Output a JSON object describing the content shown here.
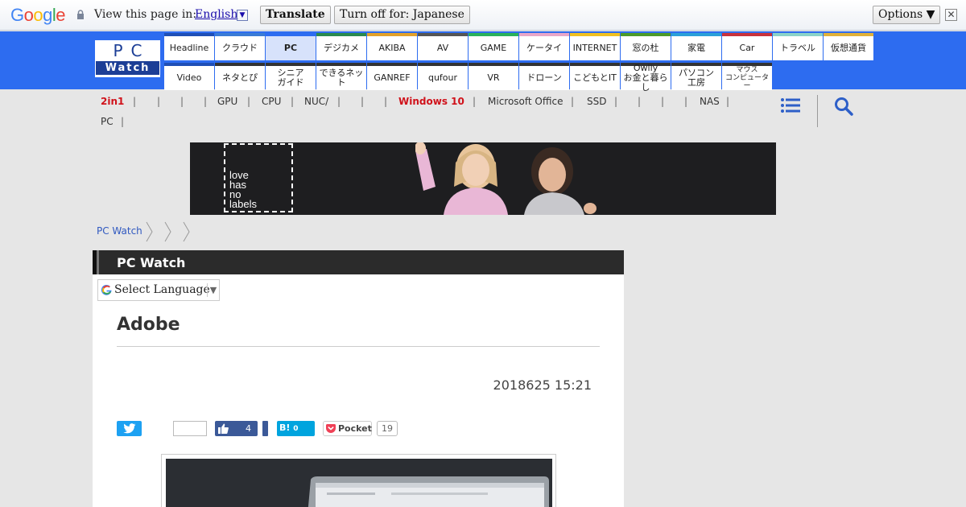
{
  "translate_bar": {
    "logo": "Google",
    "view_label": "View this page in:",
    "language": "English",
    "translate_button": "Translate",
    "turn_off_button": "Turn off for: Japanese",
    "options_button": "Options ▼",
    "close_glyph": "✕"
  },
  "site": {
    "logo_top": "PC",
    "logo_bottom": "Watch"
  },
  "nav_row1": [
    {
      "label": "Headline",
      "color": "#1f4fb5"
    },
    {
      "label": "クラウド",
      "color": "#3a7bd5"
    },
    {
      "label": "PC",
      "color": "#2d6cf0",
      "active": true
    },
    {
      "label": "デジカメ",
      "color": "#2a8a4f"
    },
    {
      "label": "AKIBA",
      "color": "#e2a12a"
    },
    {
      "label": "AV",
      "color": "#555555"
    },
    {
      "label": "GAME",
      "color": "#2ab15a"
    },
    {
      "label": "ケータイ",
      "color": "#e8a6c8"
    },
    {
      "label": "INTERNET",
      "color": "#f0c020"
    },
    {
      "label": "窓の杜",
      "color": "#4c9a2a"
    },
    {
      "label": "家電",
      "color": "#2aa0d8"
    },
    {
      "label": "Car",
      "color": "#c8323c"
    },
    {
      "label": "トラベル",
      "color": "#8ad3c8"
    },
    {
      "label": "仮想通貨",
      "color": "#e0b13a"
    }
  ],
  "nav_row2": [
    {
      "label": "Video",
      "color": "#1f4fb5"
    },
    {
      "label": "ネタとぴ",
      "color": "#333333"
    },
    {
      "label": "シニア\nガイド",
      "color": "#333333"
    },
    {
      "label": "できるネット",
      "color": "#333333"
    },
    {
      "label": "GANREF",
      "color": "#333333"
    },
    {
      "label": "qufour",
      "color": "#333333"
    },
    {
      "label": "VR",
      "color": "#333333"
    },
    {
      "label": "ドローン",
      "color": "#333333"
    },
    {
      "label": "こどもとIT",
      "color": "#333333"
    },
    {
      "label": "Owlly\nお金と暮らし",
      "color": "#333333"
    },
    {
      "label": "パソコン\n工房",
      "color": "#333333"
    },
    {
      "label": "マウス\nコンピューター",
      "color": "#333333",
      "small": true
    }
  ],
  "subnav": {
    "item_2in1": "2in1",
    "gpu": "GPU",
    "cpu": "CPU",
    "nuc": "NUC/",
    "windows10": "Windows 10",
    "office": "Microsoft Office",
    "ssd": "SSD",
    "nas": "NAS",
    "pc": "PC",
    "separator": "|"
  },
  "banner": {
    "text_line1": "love",
    "text_line2": "has",
    "text_line3": "no",
    "text_line4": "labels"
  },
  "breadcrumb": {
    "home": "PC Watch"
  },
  "article": {
    "section_title": "PC Watch",
    "language_select": "Select Language",
    "language_arrow": "▼",
    "title": "Adobe",
    "date": "2018625 15:21"
  },
  "share": {
    "facebook_count": "4",
    "hatena_label": "B!",
    "hatena_count": "0",
    "pocket_label": "Pocket",
    "pocket_count": "19"
  }
}
